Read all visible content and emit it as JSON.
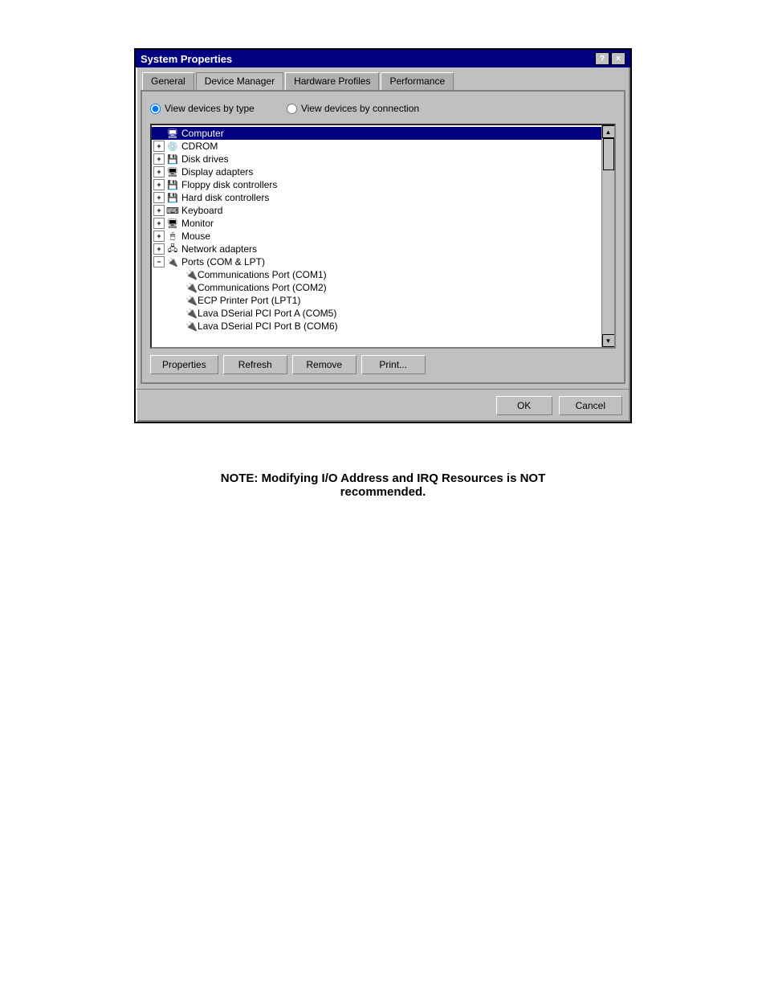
{
  "window": {
    "title": "System Properties",
    "help_btn": "?",
    "close_btn": "×"
  },
  "tabs": [
    {
      "id": "general",
      "label": "General",
      "active": false
    },
    {
      "id": "device-manager",
      "label": "Device Manager",
      "active": true
    },
    {
      "id": "hardware-profiles",
      "label": "Hardware Profiles",
      "active": false
    },
    {
      "id": "performance",
      "label": "Performance",
      "active": false
    }
  ],
  "radio": {
    "option1_label": "View devices by type",
    "option2_label": "View devices by connection"
  },
  "tree": {
    "root": "Computer",
    "items": [
      {
        "label": "Computer",
        "expand": null,
        "selected": true,
        "indent": 0
      },
      {
        "label": "CDROM",
        "expand": "+",
        "selected": false,
        "indent": 0
      },
      {
        "label": "Disk drives",
        "expand": "+",
        "selected": false,
        "indent": 0
      },
      {
        "label": "Display adapters",
        "expand": "+",
        "selected": false,
        "indent": 0
      },
      {
        "label": "Floppy disk controllers",
        "expand": "+",
        "selected": false,
        "indent": 0
      },
      {
        "label": "Hard disk controllers",
        "expand": "+",
        "selected": false,
        "indent": 0
      },
      {
        "label": "Keyboard",
        "expand": "+",
        "selected": false,
        "indent": 0
      },
      {
        "label": "Monitor",
        "expand": "+",
        "selected": false,
        "indent": 0
      },
      {
        "label": "Mouse",
        "expand": "+",
        "selected": false,
        "indent": 0
      },
      {
        "label": "Network adapters",
        "expand": "+",
        "selected": false,
        "indent": 0
      },
      {
        "label": "Ports (COM & LPT)",
        "expand": "-",
        "selected": false,
        "indent": 0,
        "expanded": true
      }
    ],
    "subitems": [
      {
        "label": "Communications Port (COM1)"
      },
      {
        "label": "Communications Port (COM2)"
      },
      {
        "label": "ECP Printer Port (LPT1)"
      },
      {
        "label": "Lava DSerial PCI Port A (COM5)"
      },
      {
        "label": "Lava DSerial PCI Port B (COM6)"
      }
    ]
  },
  "buttons": {
    "properties": "Properties",
    "refresh": "Refresh",
    "remove": "Remove",
    "print": "Print..."
  },
  "footer": {
    "ok": "OK",
    "cancel": "Cancel"
  },
  "note": "NOTE: Modifying I/O Address and IRQ Resources is NOT recommended."
}
